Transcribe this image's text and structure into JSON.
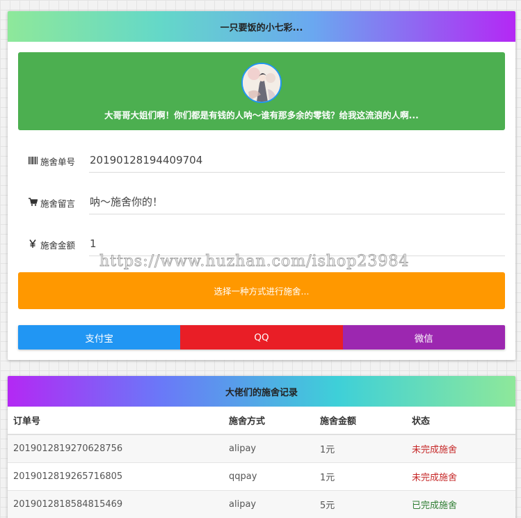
{
  "donate_card": {
    "title": "一只要饭的小七彩...",
    "banner_text": "大哥哥大姐们啊！你们都是有钱的人呐～谁有那多余的零钱？给我这流浪的人啊...",
    "fields": [
      {
        "icon": "barcode-icon",
        "label": "施舍单号",
        "value": "20190128194409704"
      },
      {
        "icon": "cart-icon",
        "label": "施舍留言",
        "value": "呐～施舍你的！"
      },
      {
        "icon": "yen-icon",
        "label": "施舍金额",
        "value": "1"
      }
    ],
    "choose_label": "选择一种方式进行施舍...",
    "pay_methods": [
      {
        "label": "支付宝",
        "color": "#2196f3"
      },
      {
        "label": "QQ",
        "color": "#e91e26"
      },
      {
        "label": "微信",
        "color": "#9c27b0"
      }
    ]
  },
  "watermark": "https://www.huzhan.com/ishop23984",
  "records_card": {
    "title": "大佬们的施舍记录",
    "columns": [
      "订单号",
      "施舍方式",
      "施舍金额",
      "状态"
    ],
    "rows": [
      {
        "order": "2019012819270628756",
        "method": "alipay",
        "amount": "1元",
        "status": "未完成施舍",
        "status_color": "#c62828"
      },
      {
        "order": "2019012819265716805",
        "method": "qqpay",
        "amount": "1元",
        "status": "未完成施舍",
        "status_color": "#c62828"
      },
      {
        "order": "2019012818584815469",
        "method": "alipay",
        "amount": "5元",
        "status": "已完成施舍",
        "status_color": "#2e7d32"
      }
    ]
  }
}
